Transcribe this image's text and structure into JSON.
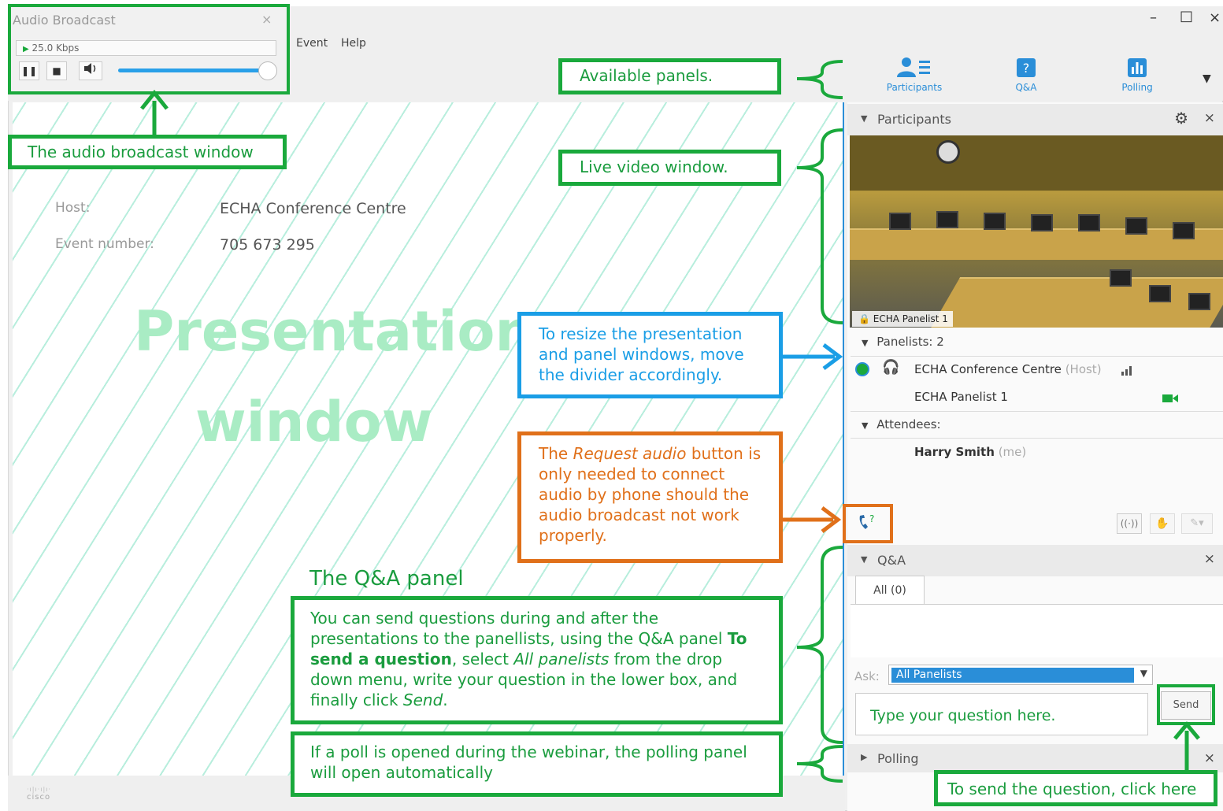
{
  "audio_window": {
    "title": "Audio Broadcast",
    "close": "×",
    "bitrate": "25.0 Kbps",
    "volume_level": 0.95
  },
  "menu": {
    "event": "Event",
    "help": "Help"
  },
  "window_controls": {
    "minimize": "–",
    "maximize": "□",
    "close": "×"
  },
  "panel_tabs": [
    {
      "label": "Participants",
      "icon": "participants-icon"
    },
    {
      "label": "Q&A",
      "icon": "qa-icon"
    },
    {
      "label": "Polling",
      "icon": "polling-icon"
    }
  ],
  "event_info": {
    "host_label": "Host:",
    "host_value": "ECHA Conference Centre",
    "number_label": "Event number:",
    "number_value": "705 673 295"
  },
  "presentation": {
    "word1": "Presentation",
    "word2": "window"
  },
  "participants": {
    "header": "Participants",
    "video_label": "ECHA Panelist 1",
    "panelists_head": "Panelists: 2",
    "panelists": [
      {
        "name": "ECHA Conference Centre",
        "role": "(Host)"
      },
      {
        "name": "ECHA Panelist 1",
        "role": ""
      }
    ],
    "attendees_head": "Attendees:",
    "attendees": [
      {
        "name": "Harry Smith",
        "role": "(me)"
      }
    ]
  },
  "qa": {
    "header": "Q&A",
    "tab_all": "All (0)",
    "ask_label": "Ask:",
    "ask_value": "All Panelists",
    "input_placeholder": "Type your question here.",
    "send": "Send"
  },
  "polling": {
    "header": "Polling"
  },
  "annotations": {
    "audio_window": "The audio broadcast window",
    "available_panels": "Available panels.",
    "live_video": "Live video window.",
    "resize_note": "To resize the presentation and panel windows, move the divider accordingly.",
    "request_audio": {
      "before": "The ",
      "em": "Request audio",
      "after": " button is only needed to connect audio by phone should the audio broadcast not work properly."
    },
    "qa_title": "The Q&A panel",
    "qa_desc": {
      "line1": "You can send questions during and after the presentations to the panellists, using the Q&A panel",
      "bold": "To send a question",
      "mid1": ", select ",
      "em1": "All panelists",
      "mid2": " from the drop down menu, write your question in the lower box, and finally click ",
      "em2": "Send",
      "end": "."
    },
    "poll_note": "If a poll is opened during the webinar, the polling panel will open automatically",
    "send_note": "To send the question, click here"
  },
  "brand": {
    "logo_text": "cisco"
  },
  "colors": {
    "annotation_green": "#1aa93c",
    "annotation_blue": "#1a9ee6",
    "annotation_orange": "#e0701a",
    "accent_blue": "#2a8ed8",
    "hatch_green": "#b8eedd"
  }
}
